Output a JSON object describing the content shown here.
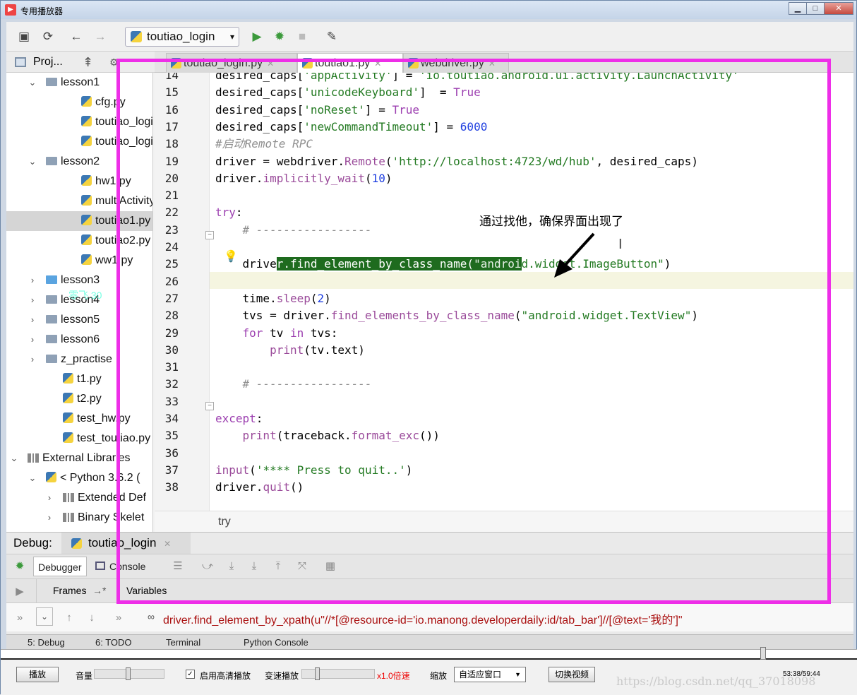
{
  "window": {
    "title": "专用播放器"
  },
  "toolbar": {
    "run_config": "toutiao_login"
  },
  "project": {
    "label": "Proj...",
    "tree": [
      {
        "label": "lesson1",
        "type": "folder",
        "arrow": "⌄"
      },
      {
        "label": "cfg.py",
        "type": "py"
      },
      {
        "label": "toutiao_login",
        "type": "py"
      },
      {
        "label": "toutiao_login",
        "type": "py"
      },
      {
        "label": "lesson2",
        "type": "folder",
        "arrow": "⌄"
      },
      {
        "label": "hw1.py",
        "type": "py"
      },
      {
        "label": "multiActivity.",
        "type": "py"
      },
      {
        "label": "toutiao1.py",
        "type": "py",
        "selected": true
      },
      {
        "label": "toutiao2.py",
        "type": "py"
      },
      {
        "label": "ww1.py",
        "type": "py"
      },
      {
        "label": "lesson3",
        "type": "folder-blue",
        "arrow": "›"
      },
      {
        "label": "lesson4",
        "type": "folder",
        "arrow": "›"
      },
      {
        "label": "lesson5",
        "type": "folder",
        "arrow": "›"
      },
      {
        "label": "lesson6",
        "type": "folder",
        "arrow": "›"
      },
      {
        "label": "z_practise",
        "type": "folder",
        "arrow": "›"
      },
      {
        "label": "t1.py",
        "type": "py"
      },
      {
        "label": "t2.py",
        "type": "py"
      },
      {
        "label": "test_hw.py",
        "type": "py"
      },
      {
        "label": "test_toutiao.py",
        "type": "py"
      },
      {
        "label": "External Libraries",
        "type": "lib",
        "arrow": "⌄"
      },
      {
        "label": "< Python 3.6.2 (",
        "type": "py",
        "arrow": "⌄"
      },
      {
        "label": "Extended Def",
        "type": "lib",
        "arrow": "›"
      },
      {
        "label": "Binary Skelet",
        "type": "lib",
        "arrow": "›"
      }
    ],
    "watermark": "零飞 30"
  },
  "tabs": [
    {
      "label": "toutiao_login.py"
    },
    {
      "label": "toutiao1.py",
      "active": true
    },
    {
      "label": "webdriver.py"
    }
  ],
  "editor": {
    "lines": [
      {
        "n": "14",
        "html": "desired_caps[<span class='str'>'appActivity'</span>] = <span class='str'>'io.toutiao.android.ui.activity.LaunchActivity'</span>"
      },
      {
        "n": "15",
        "html": "desired_caps[<span class='str'>'unicodeKeyboard'</span>]  = <span class='kw'>True</span>"
      },
      {
        "n": "16",
        "html": "desired_caps[<span class='str'>'noReset'</span>] = <span class='kw'>True</span>"
      },
      {
        "n": "17",
        "html": "desired_caps[<span class='str'>'newCommandTimeout'</span>] = <span class='num'>6000</span>"
      },
      {
        "n": "18",
        "html": "<span class='cmt'>#启动Remote RPC</span>"
      },
      {
        "n": "19",
        "html": "driver = webdriver.<span class='fn'>Remote</span>(<span class='str'>'http://localhost:4723/wd/hub'</span>, desired_caps)"
      },
      {
        "n": "20",
        "html": "driver.<span class='fn'>implicitly_wait</span>(<span class='num'>10</span>)"
      },
      {
        "n": "21",
        "html": ""
      },
      {
        "n": "22",
        "html": "<span class='kw'>try</span>:"
      },
      {
        "n": "23",
        "html": "    <span class='cmt'># -----------------</span>"
      },
      {
        "n": "24",
        "html": ""
      },
      {
        "n": "25",
        "html": "    drive<span class='hl'>r.find_element_by_class_name(<span class='str'>\"androi</span></span><span class='str'>d.widget.ImageButton\"</span>)"
      },
      {
        "n": "26",
        "html": ""
      },
      {
        "n": "27",
        "html": "    time.<span class='fn'>sleep</span>(<span class='num'>2</span>)"
      },
      {
        "n": "28",
        "html": "    tvs = driver.<span class='fn'>find_elements_by_class_name</span>(<span class='str'>\"android.widget.TextView\"</span>)"
      },
      {
        "n": "29",
        "html": "    <span class='kw'>for</span> tv <span class='kw'>in</span> tvs:"
      },
      {
        "n": "30",
        "html": "        <span class='fn'>print</span>(tv.text)"
      },
      {
        "n": "31",
        "html": ""
      },
      {
        "n": "32",
        "html": "    <span class='cmt'># -----------------</span>"
      },
      {
        "n": "33",
        "html": ""
      },
      {
        "n": "34",
        "html": "<span class='kw'>except</span>:"
      },
      {
        "n": "35",
        "html": "    <span class='fn'>print</span>(traceback.<span class='fn'>format_exc</span>())"
      },
      {
        "n": "36",
        "html": ""
      },
      {
        "n": "37",
        "html": "<span class='fn'>input</span>(<span class='str'>'**** Press to quit..'</span>)"
      },
      {
        "n": "38",
        "html": "driver.<span class='fn'>quit</span>()"
      }
    ],
    "breadcrumb": "try",
    "annotation": "通过找他，确保界面出现了"
  },
  "debug": {
    "label": "Debug:",
    "session": "toutiao_login",
    "debugger_tab": "Debugger",
    "console_tab": "Console",
    "frames_label": "Frames",
    "variables_label": "Variables",
    "watch_expr": "driver.find_element_by_xpath(u\"//*[@resource-id='io.manong.developerdaily:id/tab_bar']//[@text='我的']\"",
    "bottom_tabs": [
      "5: Debug",
      "6: TODO",
      "Terminal",
      "Python Console"
    ]
  },
  "player": {
    "play": "播放",
    "volume": "音量",
    "hd": "启用高清播放",
    "speed": "变速播放",
    "speed_value": "x1.0倍速",
    "zoom": "缩放",
    "zoom_option": "自适应窗口",
    "switch": "切换视频",
    "time": "53:38/59:44",
    "csdn": "https://blog.csdn.net/qq_37018098"
  },
  "colors": {
    "highlight_box": "#ee2ee8",
    "selection": "#1e6b1e"
  }
}
